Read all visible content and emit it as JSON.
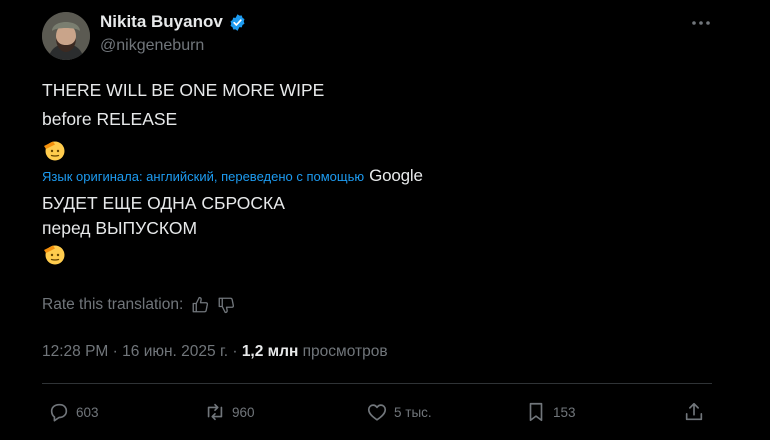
{
  "author": {
    "display_name": "Nikita Buyanov",
    "handle": "@nikgeneburn",
    "verified_icon": "verified-badge-icon",
    "verified_color": "#1d9bf0"
  },
  "tweet": {
    "original_lines": [
      "THERE WILL BE ONE MORE WIPE",
      "before RELEASE"
    ],
    "original_emoji": "saluting-face-emoji",
    "translation_note": "Язык оригинала: английский, переведено с помощью",
    "translation_provider": "Google",
    "translated_lines": [
      "БУДЕТ ЕЩЕ ОДНА СБРОСКА",
      "перед ВЫПУСКОМ"
    ],
    "translated_emoji": "saluting-face-emoji"
  },
  "rate": {
    "label": "Rate this translation:",
    "thumbs_up_icon": "thumbs-up-icon",
    "thumbs_down_icon": "thumbs-down-icon"
  },
  "meta": {
    "time": "12:28 PM",
    "date": "16 июн. 2025 г.",
    "separator": "·",
    "views_count": "1,2 млн",
    "views_label": "просмотров"
  },
  "actions": {
    "reply": {
      "icon": "reply-icon",
      "count": "603"
    },
    "repost": {
      "icon": "repost-icon",
      "count": "960"
    },
    "like": {
      "icon": "heart-icon",
      "count": "5 тыс."
    },
    "bookmark": {
      "icon": "bookmark-icon",
      "count": "153"
    },
    "share": {
      "icon": "share-icon"
    }
  },
  "colors": {
    "background": "#000000",
    "text": "#e7e9ea",
    "muted": "#71767b",
    "link": "#1d9bf0",
    "divider": "#2f3336"
  }
}
